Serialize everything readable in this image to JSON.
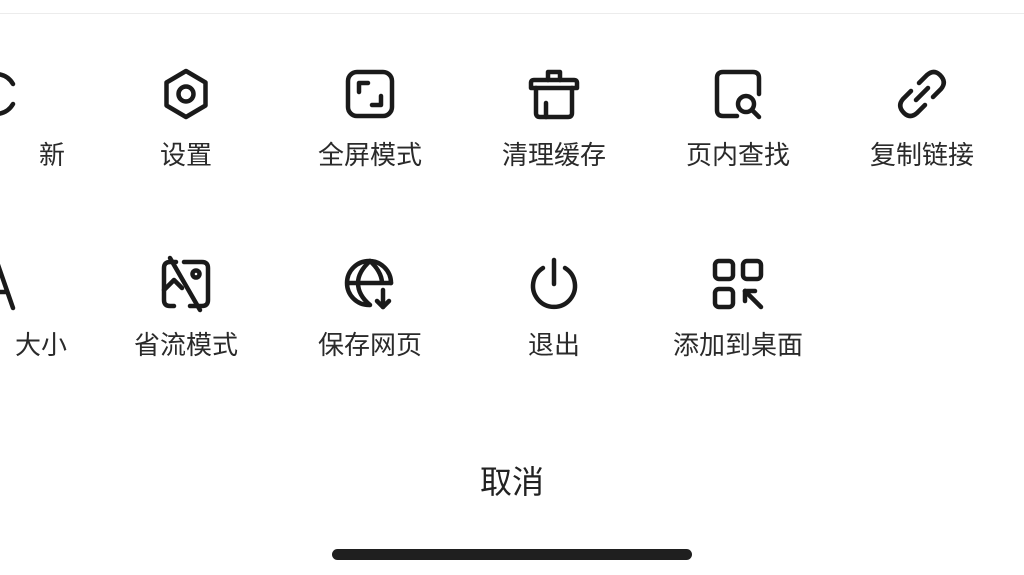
{
  "menu": {
    "row1": [
      {
        "label": "刷新",
        "icon": "refresh-icon",
        "visible_label": "新"
      },
      {
        "label": "设置",
        "icon": "settings-icon"
      },
      {
        "label": "全屏模式",
        "icon": "fullscreen-icon"
      },
      {
        "label": "清理缓存",
        "icon": "clear-cache-icon"
      },
      {
        "label": "页内查找",
        "icon": "find-in-page-icon"
      },
      {
        "label": "复制链接",
        "icon": "link-icon"
      }
    ],
    "row2": [
      {
        "label": "字体大小",
        "icon": "font-size-icon",
        "visible_label": "大小"
      },
      {
        "label": "省流模式",
        "icon": "data-saver-icon"
      },
      {
        "label": "保存网页",
        "icon": "save-webpage-icon"
      },
      {
        "label": "退出",
        "icon": "power-icon"
      },
      {
        "label": "添加到桌面",
        "icon": "qr-code-icon"
      }
    ]
  },
  "cancel_label": "取消"
}
